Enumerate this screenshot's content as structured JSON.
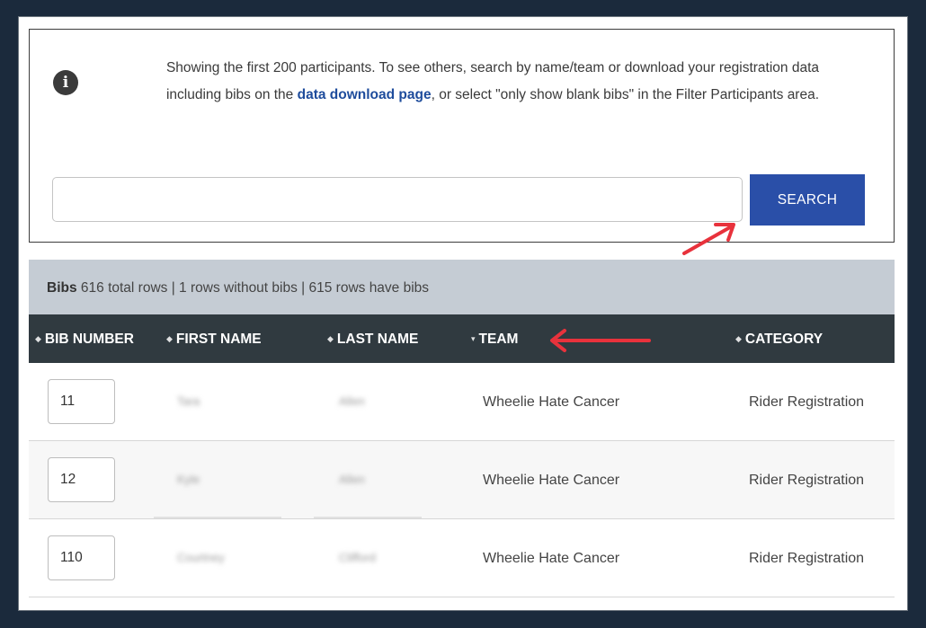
{
  "info": {
    "line1": "Showing the first 200 participants. To see others, search by name/team or download your registration data",
    "line2_pre": "including bibs on the ",
    "link_text": "data download page",
    "line2_post": ", or select \"only show blank bibs\" in the Filter Participants area."
  },
  "search": {
    "value": "",
    "placeholder": "",
    "button_label": "SEARCH"
  },
  "bibs_summary": {
    "title": "Bibs",
    "details": "616 total rows | 1 rows without bibs | 615 rows have bibs"
  },
  "table": {
    "columns": [
      {
        "label": "BIB NUMBER",
        "sort_icon": "sort-both"
      },
      {
        "label": "FIRST NAME",
        "sort_icon": "sort-both"
      },
      {
        "label": "LAST NAME",
        "sort_icon": "sort-both"
      },
      {
        "label": "TEAM",
        "sort_icon": "sort-desc"
      },
      {
        "label": "CATEGORY",
        "sort_icon": "sort-both"
      }
    ],
    "rows": [
      {
        "bib": "11",
        "first": "Tara",
        "last": "Allen",
        "team": "Wheelie Hate Cancer",
        "category": "Rider Registration"
      },
      {
        "bib": "12",
        "first": "Kyle",
        "last": "Allen",
        "team": "Wheelie Hate Cancer",
        "category": "Rider Registration"
      },
      {
        "bib": "110",
        "first": "Courtney",
        "last": "Clifford",
        "team": "Wheelie Hate Cancer",
        "category": "Rider Registration"
      }
    ]
  },
  "colors": {
    "accent": "#2a4fa8",
    "link": "#1e4c9c",
    "header_bg": "#303a40",
    "summary_bg": "#c5ccd4",
    "annotation_arrow": "#e8323c"
  }
}
